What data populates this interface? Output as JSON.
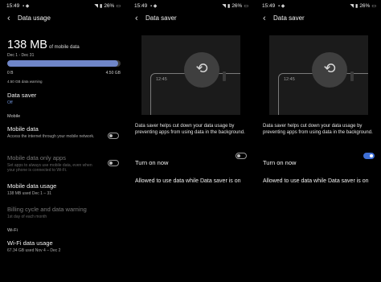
{
  "status": {
    "time": "15:49",
    "battery": "26%"
  },
  "data_usage": {
    "title": "Data usage",
    "amount": "138 MB",
    "amount_suffix": "of mobile data",
    "range": "Dec 1 - Dec 31",
    "progress_fraction": 0.98,
    "tick_min": "0 B",
    "tick_max": "4.50 GB",
    "warning": "4.50 GB data warning",
    "data_saver": {
      "title": "Data saver",
      "value": "Off"
    },
    "section_mobile": "Mobile",
    "mobile_data": {
      "title": "Mobile data",
      "subtitle": "Access the internet through your mobile network.",
      "enabled": false
    },
    "mobile_data_only_apps": {
      "title": "Mobile data only apps",
      "subtitle": "Set apps to always use mobile data, even when your phone is connected to Wi-Fi.",
      "enabled": false
    },
    "mobile_data_usage": {
      "title": "Mobile data usage",
      "subtitle": "138 MB used Dec 1 – 31"
    },
    "billing": {
      "title": "Billing cycle and data warning",
      "subtitle": "1st day of each month"
    },
    "section_wifi": "Wi-Fi",
    "wifi_usage": {
      "title": "Wi-Fi data usage",
      "subtitle": "67.34 GB used Nov 4 – Dec 2"
    }
  },
  "data_saver_screen": {
    "title": "Data saver",
    "illustration_time": "12:45",
    "description": "Data saver helps cut down your data usage by preventing apps from using data in the background.",
    "turn_on_now": "Turn on now",
    "allowed": "Allowed to use data while Data saver is on"
  },
  "panel2_toggle_on": false,
  "panel3_toggle_on": true,
  "colors": {
    "accent": "#3e6fd6",
    "bar_fill": "#6f86c8",
    "link": "#6f93d9"
  }
}
